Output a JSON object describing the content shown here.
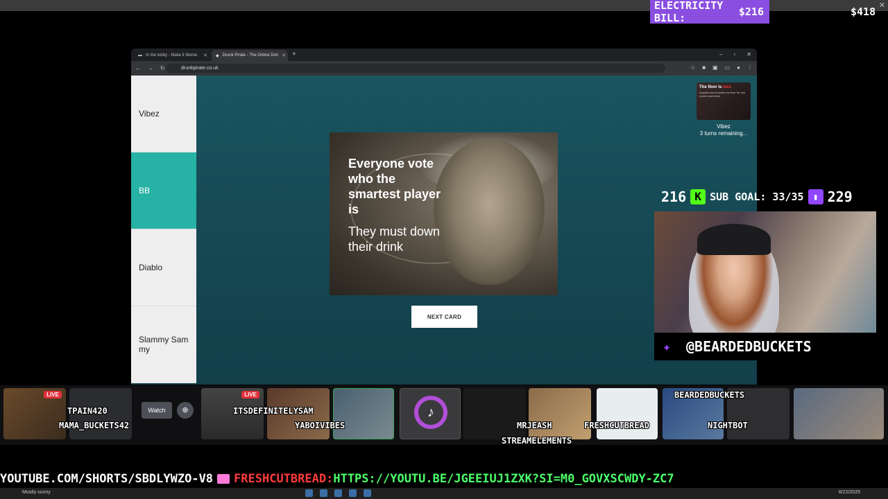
{
  "overlay": {
    "electricity_label": "ELECTRICITY BILL:",
    "electricity_value": "$216",
    "money": "$418",
    "kick_count": "216",
    "sub_goal": "SUB GOAL: 33/35",
    "twitch_count": "229",
    "handle": "@BEARDEDBUCKETS"
  },
  "browser": {
    "tabs": [
      {
        "label": "In the lobby - Make it Meme"
      },
      {
        "label": "Drunk Pirate - The Online Drin"
      }
    ],
    "url": "drunkpirate.co.uk"
  },
  "game": {
    "players": [
      {
        "name": "Vibez"
      },
      {
        "name": "BB"
      },
      {
        "name": "Diablo"
      },
      {
        "name": "Slammy Sam my"
      }
    ],
    "card_headline": "Everyone vote who the smartest player is",
    "card_subline": "They must down their drink",
    "next_label": "NEXT CARD",
    "rule_title_prefix": "The floor is ",
    "rule_title_highlight": "lava",
    "rule_desc": "Anyone who touches the floor for one round must drink",
    "rule_player": "Vibez",
    "rule_turns": "3 turns remaining..."
  },
  "strip": {
    "live_label": "LIVE",
    "watch_label": "Watch",
    "names": [
      {
        "name": "TPAIN420"
      },
      {
        "name": "MAMA_BUCKETS42"
      },
      {
        "name": "ITSDEFINITELYSAM"
      },
      {
        "name": "YABOIVIBES"
      },
      {
        "name": "MRJEASH"
      },
      {
        "name": "FRESHCUTBREAD"
      },
      {
        "name": "BEARDEDBUCKETS"
      },
      {
        "name": "NIGHTBOT"
      },
      {
        "name": "STREAMELEMENTS"
      }
    ]
  },
  "ticker": {
    "part1": "YOUTUBE.COM/SHORTS/SBDLYWZO-V8",
    "part2": "FRESHCUTBREAD:",
    "part3": "HTTPS://YOUTU.BE/JGEEIUJ1ZXK?SI=M0_GOVXSCWDY-ZC7"
  },
  "taskbar": {
    "weather": "Mostly sunny",
    "date": "8/22/2025"
  },
  "colors": {
    "accent_teal": "#26b3a5",
    "electricity_bg": "#8a4fe0",
    "twitch": "#9146ff",
    "kick": "#53fc18"
  }
}
